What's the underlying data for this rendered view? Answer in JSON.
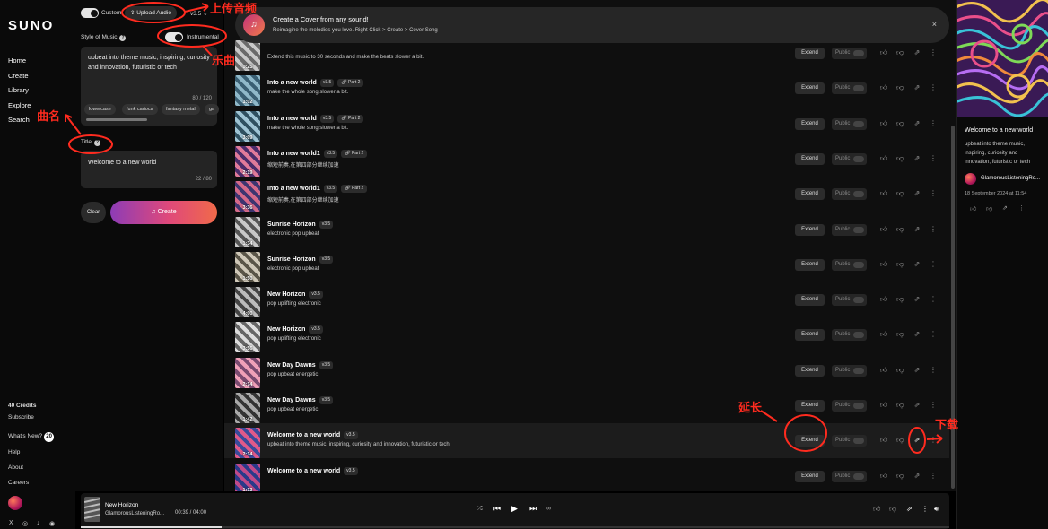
{
  "nav": {
    "logo": "SUNO",
    "items": [
      "Home",
      "Create",
      "Library",
      "Explore",
      "Search"
    ],
    "credits": "40 Credits",
    "subscribe": "Subscribe",
    "whats_new": "What's New?",
    "whats_new_count": "20",
    "help": "Help",
    "about": "About",
    "careers": "Careers",
    "social": [
      "X",
      "◎",
      "♪",
      "◉"
    ]
  },
  "create": {
    "custom_label": "Custom",
    "upload_label": "Upload Audio",
    "version": "v3.5",
    "style_label": "Style of Music",
    "instrumental_label": "Instrumental",
    "style_text": "upbeat into theme music, inspiring, curiosity and innovation, futuristic or tech",
    "style_count": "80 / 120",
    "style_tags": [
      "lowercase",
      "funk carioca",
      "fantasy metal",
      "ga"
    ],
    "title_label": "Title",
    "title_value": "Welcome to a new world",
    "title_count": "22 / 80",
    "clear_label": "Clear",
    "create_label": "Create"
  },
  "banner": {
    "title": "Create a Cover from any sound!",
    "subtitle": "Reimagine the melodies you love. Right Click > Create > Cover Song",
    "close": "×"
  },
  "songs": [
    {
      "title": "",
      "version": "",
      "part": "",
      "desc": "Extend this music to 30 seconds and make the beats slower a bit.",
      "duration": "0:25"
    },
    {
      "title": "Into a new world",
      "version": "v3.5",
      "part": "Part 2",
      "desc": "make the whole song slower a bit.",
      "duration": "1:02"
    },
    {
      "title": "Into a new world",
      "version": "v3.5",
      "part": "Part 2",
      "desc": "make the whole song slower a bit.",
      "duration": "3:09"
    },
    {
      "title": "Into a new world1",
      "version": "v3.5",
      "part": "Part 2",
      "desc": "缩短前奏,在第四部分继续加速",
      "duration": "2:19"
    },
    {
      "title": "Into a new world1",
      "version": "v3.5",
      "part": "Part 2",
      "desc": "缩短前奏,在第四部分继续加速",
      "duration": "3:36"
    },
    {
      "title": "Sunrise Horizon",
      "version": "v3.5",
      "part": "",
      "desc": "electronic pop upbeat",
      "duration": "1:34"
    },
    {
      "title": "Sunrise Horizon",
      "version": "v3.5",
      "part": "",
      "desc": "electronic pop upbeat",
      "duration": "1:50"
    },
    {
      "title": "New Horizon",
      "version": "v3.5",
      "part": "",
      "desc": "pop uplifting electronic",
      "duration": "4:00"
    },
    {
      "title": "New Horizon",
      "version": "v3.5",
      "part": "",
      "desc": "pop uplifting electronic",
      "duration": "3:56"
    },
    {
      "title": "New Day Dawns",
      "version": "v3.5",
      "part": "",
      "desc": "pop upbeat energetic",
      "duration": "2:14"
    },
    {
      "title": "New Day Dawns",
      "version": "v3.5",
      "part": "",
      "desc": "pop upbeat energetic",
      "duration": "1:42"
    },
    {
      "title": "Welcome to a new world",
      "version": "v3.5",
      "part": "",
      "desc": "upbeat into theme music, inspiring, curiosity and innovation, futuristic or tech",
      "duration": "2:14"
    },
    {
      "title": "Welcome to a new world",
      "version": "v3.5",
      "part": "",
      "desc": "",
      "duration": "1:13"
    }
  ],
  "song_actions": {
    "extend": "Extend",
    "public": "Public"
  },
  "detail": {
    "title": "Welcome to a new world",
    "desc": "upbeat into theme music, inspiring, curiosity and innovation, futuristic or tech",
    "user": "GlamorousListeningRo...",
    "date": "18 September 2024 at 11:54"
  },
  "player": {
    "title": "New Horizon",
    "user": "GlamorousListeningRo...",
    "time": "00:39 / 04:00",
    "progress": 0.1625
  },
  "annotations": {
    "upload": "上传音频",
    "instrumental": "乐曲",
    "title": "曲名",
    "extend": "延长",
    "download": "下载"
  },
  "colors": {
    "accent_start": "#8d3cb6",
    "accent_end": "#f06a4a",
    "annotation": "#ff2b1f"
  }
}
